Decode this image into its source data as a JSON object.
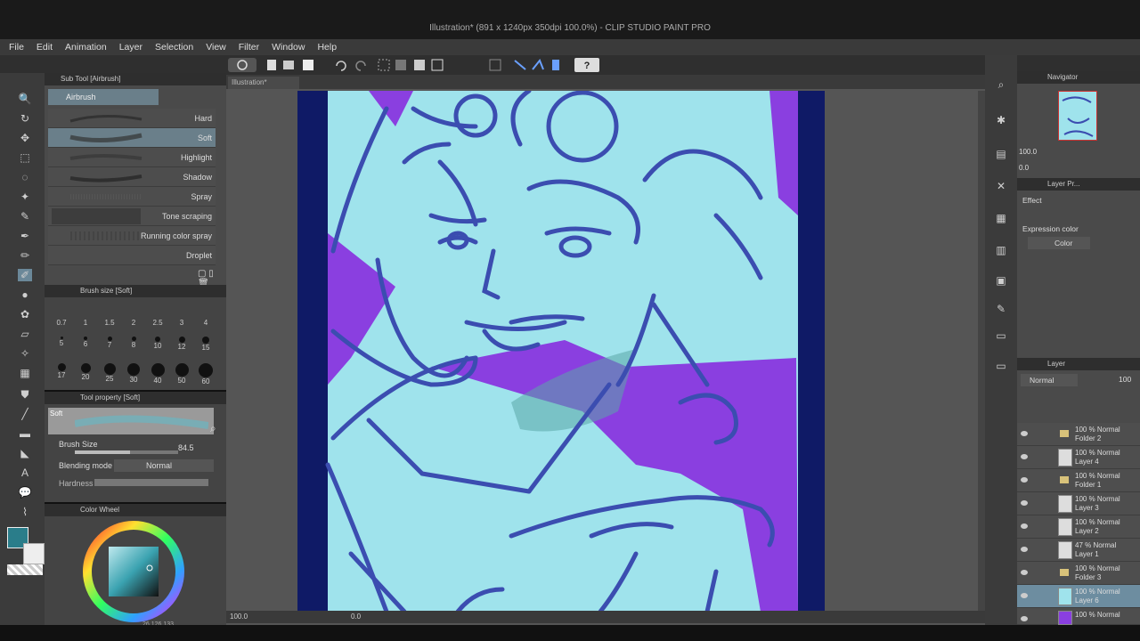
{
  "window": {
    "title": "Illustration* (891 x 1240px 350dpi 100.0%) - CLIP STUDIO PAINT PRO"
  },
  "menu": [
    "File",
    "Edit",
    "Animation",
    "Layer",
    "Selection",
    "View",
    "Filter",
    "Window",
    "Help"
  ],
  "subtool": {
    "header": "Sub Tool [Airbrush]",
    "group": "Airbrush",
    "items": [
      {
        "label": "Hard",
        "selected": false
      },
      {
        "label": "Soft",
        "selected": true
      },
      {
        "label": "Highlight",
        "selected": false
      },
      {
        "label": "Shadow",
        "selected": false
      },
      {
        "label": "Spray",
        "selected": false
      },
      {
        "label": "Tone scraping",
        "selected": false
      },
      {
        "label": "Running color spray",
        "selected": false
      },
      {
        "label": "Droplet",
        "selected": false
      }
    ]
  },
  "brush_size": {
    "header": "Brush size [Soft]",
    "sizes": [
      "0.7",
      "1",
      "1.5",
      "2",
      "2.5",
      "3",
      "4",
      "5",
      "6",
      "7",
      "8",
      "10",
      "12",
      "15",
      "17",
      "20",
      "25",
      "30",
      "40",
      "50",
      "60"
    ]
  },
  "tool_property": {
    "header": "Tool property [Soft]",
    "preview_label": "Soft",
    "brush_size_label": "Brush Size",
    "brush_size_value": "84.5",
    "blending_label": "Blending mode",
    "blending_value": "Normal",
    "hardness_label": "Hardness"
  },
  "color_panel": {
    "header": "Color Wheel",
    "main_color": "#2a7d8a",
    "values": [
      "26",
      "126",
      "133"
    ]
  },
  "canvas": {
    "tab": "Illustration*",
    "zoom": "100.0",
    "angle": "0.0",
    "bg_color": "#9fe3ec",
    "border_color": "#0f1a66",
    "accent_purple": "#8a3fe0",
    "line_color": "#3b4db0"
  },
  "navigator": {
    "header": "Navigator",
    "zoom": "100.0",
    "angle": "0.0"
  },
  "layer_property": {
    "header": "Layer Pr...",
    "effect_label": "Effect",
    "expression_label": "Expression color",
    "expression_value": "Color"
  },
  "layer_panel": {
    "header": "Layer",
    "blend_mode": "Normal",
    "opacity": "100",
    "layers": [
      {
        "line1": "100 % Normal",
        "line2": "Folder 2",
        "type": "folder",
        "selected": false
      },
      {
        "line1": "100 % Normal",
        "line2": "Layer 4",
        "type": "layer",
        "selected": false
      },
      {
        "line1": "100 % Normal",
        "line2": "Folder 1",
        "type": "folder",
        "selected": false
      },
      {
        "line1": "100 % Normal",
        "line2": "Layer 3",
        "type": "layer",
        "selected": false
      },
      {
        "line1": "100 % Normal",
        "line2": "Layer 2",
        "type": "layer",
        "selected": false
      },
      {
        "line1": "47 % Normal",
        "line2": "Layer 1",
        "type": "layer",
        "selected": false
      },
      {
        "line1": "100 % Normal",
        "line2": "Folder 3",
        "type": "folder",
        "selected": false
      },
      {
        "line1": "100 % Normal",
        "line2": "Layer 6",
        "type": "layer",
        "selected": true
      },
      {
        "line1": "100 % Normal",
        "line2": "",
        "type": "layer",
        "selected": false
      }
    ]
  }
}
